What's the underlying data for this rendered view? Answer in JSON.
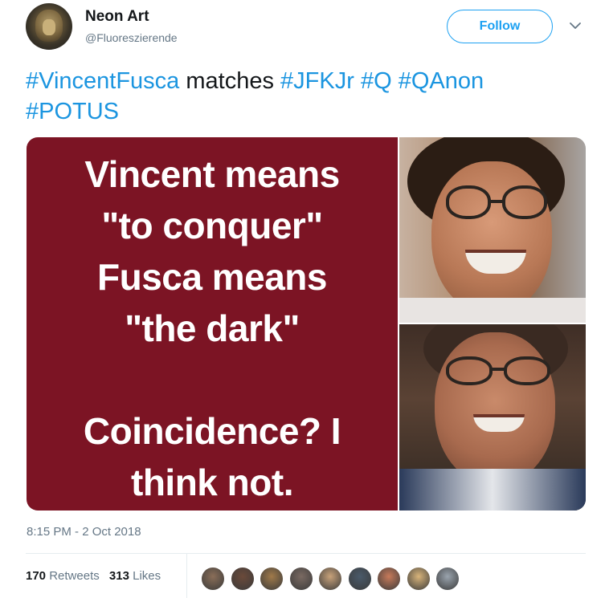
{
  "author": {
    "display_name": "Neon Art",
    "handle": "@Fluoreszierende",
    "avatar_icon": "lion-avatar"
  },
  "actions": {
    "follow_label": "Follow",
    "more_icon": "chevron-down-icon"
  },
  "tweet": {
    "parts": [
      {
        "text": "#VincentFusca",
        "hashtag": true
      },
      {
        "text": " matches ",
        "hashtag": false
      },
      {
        "text": "#JFKJr",
        "hashtag": true
      },
      {
        "text": " ",
        "hashtag": false
      },
      {
        "text": "#Q",
        "hashtag": true
      },
      {
        "text": " ",
        "hashtag": false
      },
      {
        "text": "#QAnon",
        "hashtag": true
      },
      {
        "text": " ",
        "hashtag": false
      },
      {
        "text": "#POTUS",
        "hashtag": true
      }
    ],
    "hashtag_color": "#1b95e0"
  },
  "media": {
    "meme_background": "#7c1424",
    "meme_lines": [
      "Vincent means",
      "\"to conquer\"",
      "Fusca means",
      "\"the dark\"",
      "",
      "Coincidence? I",
      "think not."
    ]
  },
  "meta": {
    "timestamp": "8:15 PM - 2 Oct 2018"
  },
  "stats": {
    "retweets_count": "170",
    "retweets_label": "Retweets",
    "likes_count": "313",
    "likes_label": "Likes"
  },
  "likers": [
    "#8a6e58",
    "#6b4a3a",
    "#a07a4a",
    "#7a6a62",
    "#c8a27a",
    "#4a5a6a",
    "#c77a5a",
    "#d8b47a",
    "#9aa4ae"
  ]
}
